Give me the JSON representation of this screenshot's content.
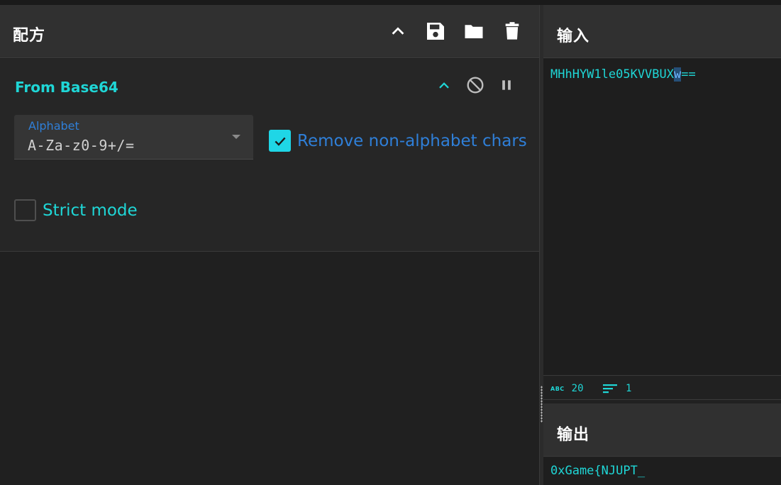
{
  "recipe": {
    "title": "配方",
    "buttons": [
      "collapse-all",
      "save-recipe",
      "load-recipe",
      "clear-recipe"
    ]
  },
  "operation": {
    "name": "From Base64",
    "alphabet": {
      "label": "Alphabet",
      "value": "A-Za-z0-9+/="
    },
    "remove_non_alphabet": {
      "label": "Remove non-alphabet chars",
      "checked": true
    },
    "strict_mode": {
      "label": "Strict mode",
      "checked": false
    }
  },
  "input": {
    "title": "输入",
    "text_before": "MHhHYW1le05KVVBUX",
    "text_selected": "w",
    "text_after": "=="
  },
  "status": {
    "length": "20",
    "lines": "1"
  },
  "output": {
    "title": "输出",
    "text": "0xGame{NJUPT_"
  },
  "colors": {
    "accent_cyan": "#1fd6d6",
    "accent_blue": "#2f7fd8",
    "background": "#212121",
    "header": "#303030"
  }
}
